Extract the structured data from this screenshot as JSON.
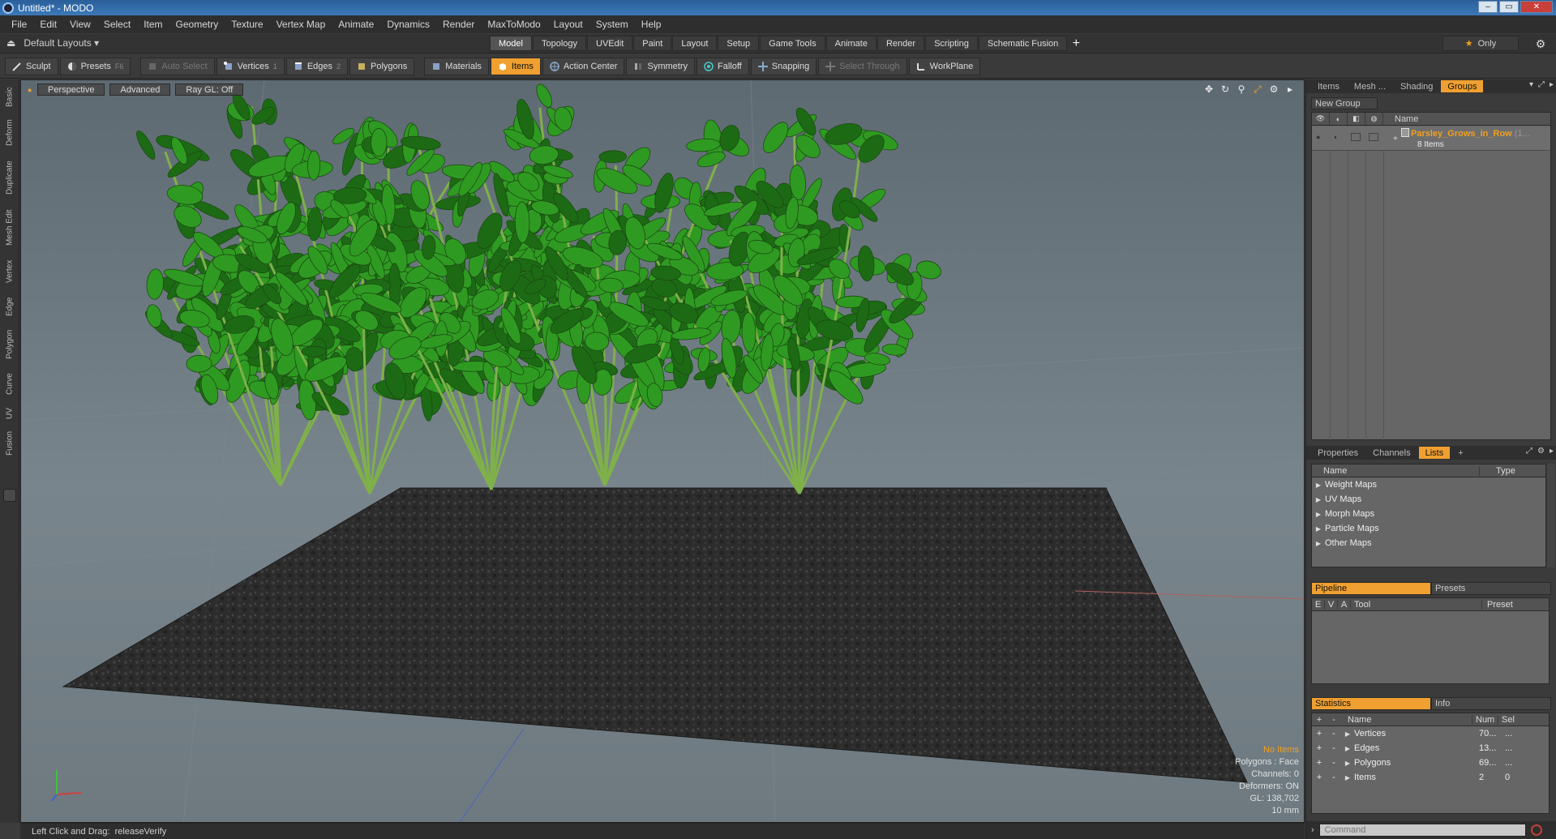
{
  "window": {
    "title": "Untitled* - MODO",
    "min": "–",
    "max": "▭",
    "close": "✕"
  },
  "menu": [
    "File",
    "Edit",
    "View",
    "Select",
    "Item",
    "Geometry",
    "Texture",
    "Vertex Map",
    "Animate",
    "Dynamics",
    "Render",
    "MaxToModo",
    "Layout",
    "System",
    "Help"
  ],
  "layout": {
    "current": "Default Layouts",
    "tabs": [
      "Model",
      "Topology",
      "UVEdit",
      "Paint",
      "Layout",
      "Setup",
      "Game Tools",
      "Animate",
      "Render",
      "Scripting",
      "Schematic Fusion"
    ],
    "active_tab": "Model",
    "plus": "+",
    "only": "Only"
  },
  "toolbar": {
    "sculpt": "Sculpt",
    "presets": "Presets",
    "presets_hotkey": "F6",
    "auto_select": "Auto Select",
    "vertices": "Vertices",
    "vertices_hotkey": "1",
    "edges": "Edges",
    "edges_hotkey": "2",
    "polygons": "Polygons",
    "materials": "Materials",
    "items": "Items",
    "action_center": "Action Center",
    "symmetry": "Symmetry",
    "falloff": "Falloff",
    "snapping": "Snapping",
    "select_through": "Select Through",
    "workplane": "WorkPlane"
  },
  "left_tabs": [
    "Basic",
    "Deform",
    "Duplicate",
    "Mesh Edit",
    "Vertex",
    "Edge",
    "Polygon",
    "Curve",
    "UV",
    "Fusion"
  ],
  "viewport": {
    "view_mode": "Perspective",
    "shading": "Advanced",
    "raygl": "Ray GL: Off",
    "stats": {
      "no_items": "No Items",
      "polygons": "Polygons : Face",
      "channels": "Channels: 0",
      "deformers": "Deformers: ON",
      "gl": "GL: 138,702",
      "grid": "10 mm"
    }
  },
  "status": {
    "hint": "Left Click and Drag:",
    "action": "releaseVerify"
  },
  "groups_panel": {
    "tabs": [
      "Items",
      "Mesh ...",
      "Shading",
      "Groups"
    ],
    "active_tab": "Groups",
    "new_group": "New Group",
    "col_name": "Name",
    "group_name": "Parsley_Grows_in_Row",
    "group_suffix": "(1...",
    "group_count": "8 Items"
  },
  "lists_panel": {
    "tabs": [
      "Properties",
      "Channels",
      "Lists"
    ],
    "active_tab": "Lists",
    "plus": "+",
    "col_name": "Name",
    "col_type": "Type",
    "items": [
      "Weight Maps",
      "UV Maps",
      "Morph Maps",
      "Particle Maps",
      "Other Maps"
    ]
  },
  "pipeline_panel": {
    "tabs": [
      "Pipeline",
      "Presets"
    ],
    "cols": [
      "E",
      "V",
      "A",
      "Tool",
      "Preset"
    ]
  },
  "stats_panel": {
    "tabs": [
      "Statistics",
      "Info"
    ],
    "cols": [
      "Name",
      "Num",
      "Sel"
    ],
    "rows": [
      {
        "name": "Vertices",
        "num": "70...",
        "sel": "..."
      },
      {
        "name": "Edges",
        "num": "13...",
        "sel": "..."
      },
      {
        "name": "Polygons",
        "num": "69...",
        "sel": "..."
      },
      {
        "name": "Items",
        "num": "2",
        "sel": "0"
      }
    ]
  },
  "command": {
    "placeholder": "Command"
  },
  "colors": {
    "accent": "#f0a030",
    "leaf": "#2f9a22",
    "leaf_dark": "#1d6a15",
    "stem": "#7fb04a",
    "soil": "#2a2a2a"
  }
}
